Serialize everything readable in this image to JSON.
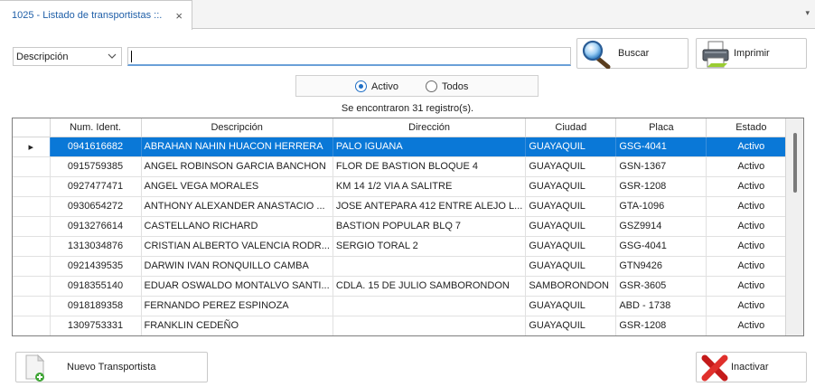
{
  "tab": {
    "title": "1025 - Listado de transportistas ::.",
    "close": "×",
    "menu": "▾"
  },
  "search": {
    "field_selected": "Descripción",
    "value": "",
    "buscar_label": "Buscar",
    "imprimir_label": "Imprimir"
  },
  "filter": {
    "options": [
      {
        "label": "Activo",
        "selected": true
      },
      {
        "label": "Todos",
        "selected": false
      }
    ]
  },
  "count_text": "Se encontraron 31 registro(s).",
  "table": {
    "columns": [
      "",
      "Num. Ident.",
      "Descripción",
      "Dirección",
      "Ciudad",
      "Placa",
      "Estado"
    ],
    "rows": [
      [
        "▸",
        "0941616682",
        "ABRAHAN NAHIN HUACON HERRERA",
        "PALO IGUANA",
        "GUAYAQUIL",
        "GSG-4041",
        "Activo"
      ],
      [
        "",
        "0915759385",
        "ANGEL ROBINSON GARCIA BANCHON",
        "FLOR DE BASTION BLOQUE 4",
        "GUAYAQUIL",
        "GSN-1367",
        "Activo"
      ],
      [
        "",
        "0927477471",
        "ANGEL VEGA MORALES",
        "KM 14 1/2 VIA A SALITRE",
        "GUAYAQUIL",
        "GSR-1208",
        "Activo"
      ],
      [
        "",
        "0930654272",
        "ANTHONY ALEXANDER ANASTACIO ...",
        "JOSE ANTEPARA 412 ENTRE ALEJO L...",
        "GUAYAQUIL",
        "GTA-1096",
        "Activo"
      ],
      [
        "",
        "0913276614",
        "CASTELLANO RICHARD",
        "BASTION POPULAR BLQ 7",
        "GUAYAQUIL",
        "GSZ9914",
        "Activo"
      ],
      [
        "",
        "1313034876",
        "CRISTIAN ALBERTO VALENCIA RODR...",
        "SERGIO TORAL 2",
        "GUAYAQUIL",
        "GSG-4041",
        "Activo"
      ],
      [
        "",
        "0921439535",
        "DARWIN IVAN RONQUILLO CAMBA",
        "",
        "GUAYAQUIL",
        "GTN9426",
        "Activo"
      ],
      [
        "",
        "0918355140",
        "EDUAR OSWALDO MONTALVO SANTI...",
        "CDLA. 15 DE JULIO SAMBORONDON",
        "SAMBORONDON",
        "GSR-3605",
        "Activo"
      ],
      [
        "",
        "0918189358",
        "FERNANDO PEREZ ESPINOZA",
        "",
        "GUAYAQUIL",
        "ABD - 1738",
        "Activo"
      ],
      [
        "",
        "1309753331",
        "FRANKLIN CEDEÑO",
        "",
        "GUAYAQUIL",
        "GSR-1208",
        "Activo"
      ]
    ]
  },
  "footer": {
    "nuevo_label": "Nuevo Transportista",
    "inactivar_label": "Inactivar"
  },
  "colors": {
    "accent": "#0a78d7",
    "tab_text": "#1f5fa8",
    "delete_red": "#d9201f"
  },
  "icons": {
    "buscar": "magnifier-icon",
    "imprimir": "printer-icon",
    "nuevo": "new-document-icon",
    "inactivar": "red-x-icon"
  }
}
